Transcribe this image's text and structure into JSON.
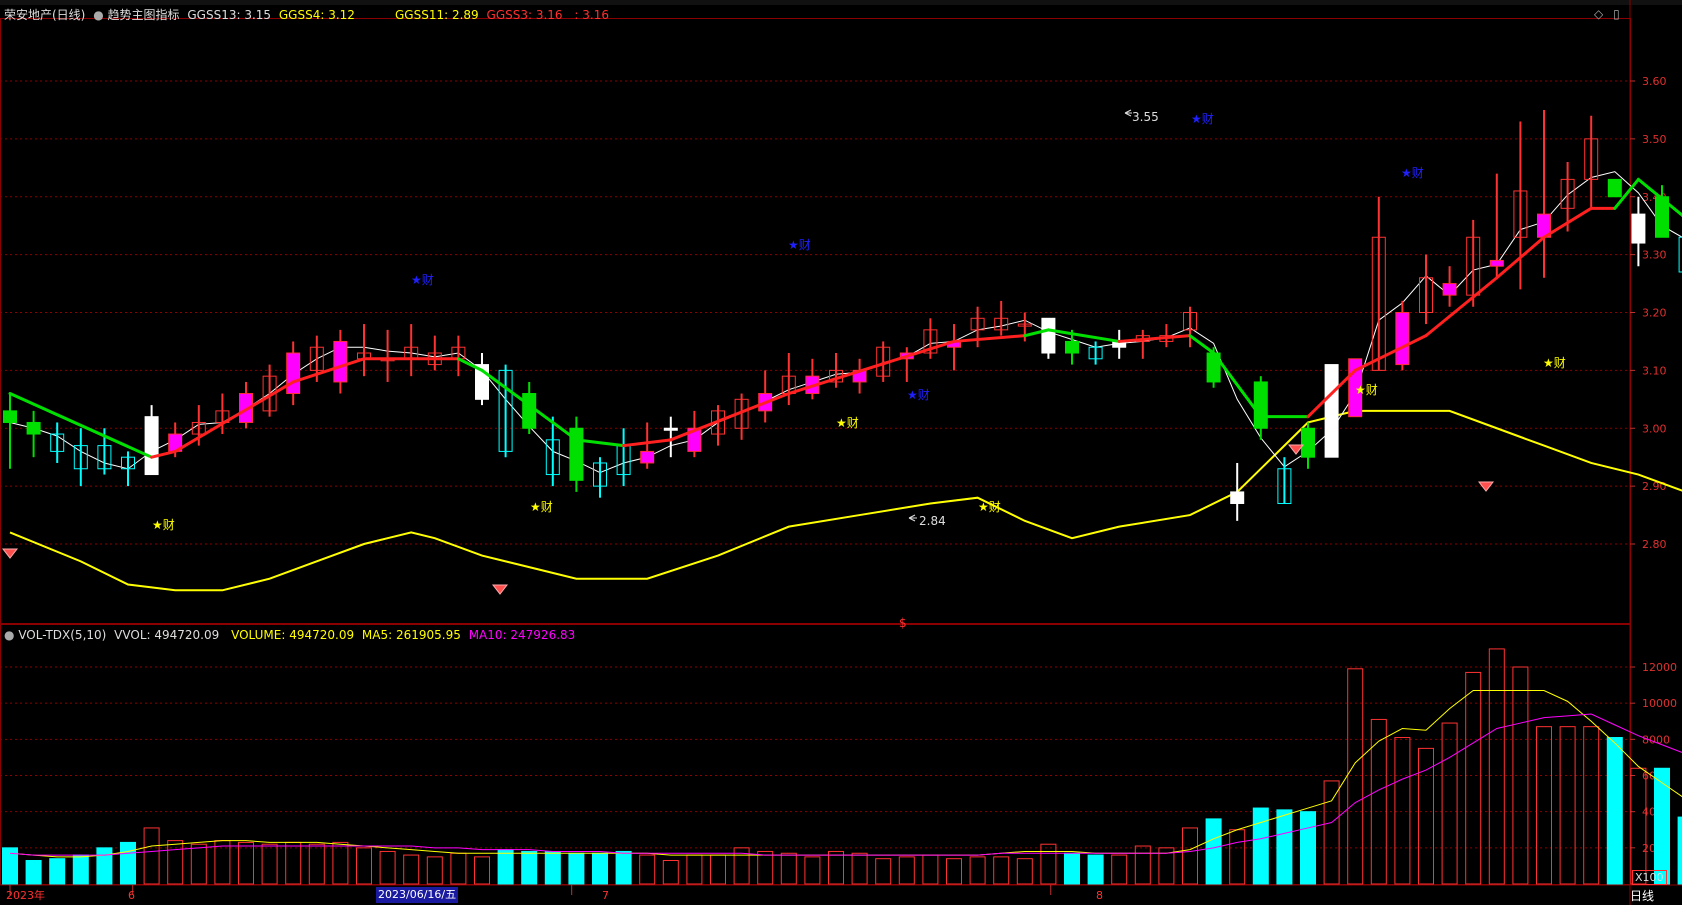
{
  "header": {
    "stock_name": "荣安地产(日线)",
    "indicator_name": "趋势主图指标",
    "ggss13": "GGSS13: 3.15",
    "ggss4": "GGSS4: 3.12",
    "ggss11": "GGSS11: 2.89",
    "ggss3": "GGSS3: 3.16",
    "extra": ": 3.16"
  },
  "vol_header": {
    "name": "VOL-TDX(5,10)",
    "vvol": "VVOL: 494720.09",
    "volume": "VOLUME: 494720.09",
    "ma5": "MA5: 261905.95",
    "ma10": "MA10: 247926.83"
  },
  "bottom": {
    "year_label": "2023年",
    "m6": "6",
    "date_label": "2023/06/16/五",
    "m7": "7",
    "m8": "8",
    "period": "日线",
    "vol_unit": "X100"
  },
  "annotations": {
    "high_label": "3.55",
    "low_label": "2.84",
    "cai": "★财",
    "dollar": "$"
  },
  "colors": {
    "up": "#ff3232",
    "up_fill": "#ff00ff",
    "down": "#00ffff",
    "white": "#ffffff",
    "green_line": "#00e000",
    "red_line": "#ff2020",
    "yellow": "#ffff00",
    "magenta": "#ff00ff",
    "grid": "#8b0000"
  },
  "chart_data": {
    "type": "candlestick",
    "price_axis": {
      "ticks": [
        2.8,
        2.9,
        3.0,
        3.1,
        3.2,
        3.3,
        3.4,
        3.5,
        3.6
      ]
    },
    "volume_axis": {
      "ticks": [
        2000,
        4000,
        6000,
        8000,
        10000,
        12000
      ]
    },
    "candles": [
      {
        "o": 3.03,
        "h": 3.06,
        "l": 2.93,
        "c": 3.01,
        "v": 2000,
        "k": "g"
      },
      {
        "o": 3.01,
        "h": 3.03,
        "l": 2.95,
        "c": 2.99,
        "v": 1300,
        "k": "g"
      },
      {
        "o": 2.99,
        "h": 3.01,
        "l": 2.94,
        "c": 2.96,
        "v": 1400,
        "k": "d"
      },
      {
        "o": 2.97,
        "h": 3.0,
        "l": 2.9,
        "c": 2.93,
        "v": 1600,
        "k": "d"
      },
      {
        "o": 2.97,
        "h": 3.0,
        "l": 2.92,
        "c": 2.93,
        "v": 2000,
        "k": "d"
      },
      {
        "o": 2.95,
        "h": 2.96,
        "l": 2.9,
        "c": 2.93,
        "v": 2300,
        "k": "d"
      },
      {
        "o": 2.92,
        "h": 3.04,
        "l": 2.92,
        "c": 3.02,
        "v": 3100,
        "k": "w"
      },
      {
        "o": 2.96,
        "h": 3.01,
        "l": 2.95,
        "c": 2.99,
        "v": 2400,
        "k": "m"
      },
      {
        "o": 2.99,
        "h": 3.04,
        "l": 2.97,
        "c": 3.01,
        "v": 2200,
        "k": "r"
      },
      {
        "o": 3.01,
        "h": 3.06,
        "l": 2.99,
        "c": 3.03,
        "v": 2400,
        "k": "r"
      },
      {
        "o": 3.01,
        "h": 3.08,
        "l": 3.0,
        "c": 3.06,
        "v": 2300,
        "k": "m"
      },
      {
        "o": 3.03,
        "h": 3.11,
        "l": 3.02,
        "c": 3.09,
        "v": 2200,
        "k": "r"
      },
      {
        "o": 3.06,
        "h": 3.15,
        "l": 3.04,
        "c": 3.13,
        "v": 2300,
        "k": "m"
      },
      {
        "o": 3.1,
        "h": 3.16,
        "l": 3.08,
        "c": 3.14,
        "v": 2200,
        "k": "r"
      },
      {
        "o": 3.08,
        "h": 3.17,
        "l": 3.06,
        "c": 3.15,
        "v": 2300,
        "k": "m"
      },
      {
        "o": 3.12,
        "h": 3.18,
        "l": 3.09,
        "c": 3.13,
        "v": 2000,
        "k": "r"
      },
      {
        "o": 3.12,
        "h": 3.17,
        "l": 3.08,
        "c": 3.12,
        "v": 1800,
        "k": "r"
      },
      {
        "o": 3.12,
        "h": 3.18,
        "l": 3.09,
        "c": 3.14,
        "v": 1600,
        "k": "r"
      },
      {
        "o": 3.13,
        "h": 3.16,
        "l": 3.1,
        "c": 3.11,
        "v": 1500,
        "k": "r"
      },
      {
        "o": 3.12,
        "h": 3.16,
        "l": 3.09,
        "c": 3.14,
        "v": 1700,
        "k": "r"
      },
      {
        "o": 3.11,
        "h": 3.13,
        "l": 3.04,
        "c": 3.05,
        "v": 1500,
        "k": "w"
      },
      {
        "o": 3.1,
        "h": 3.11,
        "l": 2.95,
        "c": 2.96,
        "v": 1900,
        "k": "d"
      },
      {
        "o": 3.06,
        "h": 3.08,
        "l": 2.99,
        "c": 3.0,
        "v": 1800,
        "k": "g"
      },
      {
        "o": 2.98,
        "h": 3.02,
        "l": 2.9,
        "c": 2.92,
        "v": 1800,
        "k": "d"
      },
      {
        "o": 3.0,
        "h": 3.02,
        "l": 2.89,
        "c": 2.91,
        "v": 1700,
        "k": "g"
      },
      {
        "o": 2.9,
        "h": 2.95,
        "l": 2.88,
        "c": 2.94,
        "v": 1700,
        "k": "d"
      },
      {
        "o": 2.92,
        "h": 3.0,
        "l": 2.9,
        "c": 2.97,
        "v": 1800,
        "k": "d"
      },
      {
        "o": 2.96,
        "h": 3.01,
        "l": 2.93,
        "c": 2.94,
        "v": 1600,
        "k": "m"
      },
      {
        "o": 3.0,
        "h": 3.02,
        "l": 2.95,
        "c": 3.0,
        "v": 1300,
        "k": "w"
      },
      {
        "o": 2.96,
        "h": 3.03,
        "l": 2.95,
        "c": 3.0,
        "v": 1600,
        "k": "m"
      },
      {
        "o": 2.99,
        "h": 3.04,
        "l": 2.97,
        "c": 3.03,
        "v": 1600,
        "k": "r"
      },
      {
        "o": 3.0,
        "h": 3.06,
        "l": 2.98,
        "c": 3.05,
        "v": 2000,
        "k": "r"
      },
      {
        "o": 3.03,
        "h": 3.1,
        "l": 3.01,
        "c": 3.06,
        "v": 1800,
        "k": "m"
      },
      {
        "o": 3.06,
        "h": 3.13,
        "l": 3.04,
        "c": 3.09,
        "v": 1700,
        "k": "r"
      },
      {
        "o": 3.06,
        "h": 3.12,
        "l": 3.05,
        "c": 3.09,
        "v": 1500,
        "k": "m"
      },
      {
        "o": 3.08,
        "h": 3.13,
        "l": 3.07,
        "c": 3.1,
        "v": 1800,
        "k": "r"
      },
      {
        "o": 3.08,
        "h": 3.12,
        "l": 3.06,
        "c": 3.1,
        "v": 1700,
        "k": "m"
      },
      {
        "o": 3.09,
        "h": 3.15,
        "l": 3.08,
        "c": 3.14,
        "v": 1400,
        "k": "r"
      },
      {
        "o": 3.12,
        "h": 3.14,
        "l": 3.08,
        "c": 3.13,
        "v": 1500,
        "k": "m"
      },
      {
        "o": 3.13,
        "h": 3.19,
        "l": 3.12,
        "c": 3.17,
        "v": 1600,
        "k": "r"
      },
      {
        "o": 3.14,
        "h": 3.18,
        "l": 3.1,
        "c": 3.15,
        "v": 1400,
        "k": "m"
      },
      {
        "o": 3.17,
        "h": 3.21,
        "l": 3.14,
        "c": 3.19,
        "v": 1500,
        "k": "r"
      },
      {
        "o": 3.17,
        "h": 3.22,
        "l": 3.16,
        "c": 3.19,
        "v": 1500,
        "k": "r"
      },
      {
        "o": 3.18,
        "h": 3.2,
        "l": 3.15,
        "c": 3.18,
        "v": 1400,
        "k": "r"
      },
      {
        "o": 3.19,
        "h": 3.19,
        "l": 3.12,
        "c": 3.13,
        "v": 2200,
        "k": "w"
      },
      {
        "o": 3.13,
        "h": 3.17,
        "l": 3.11,
        "c": 3.15,
        "v": 1700,
        "k": "g"
      },
      {
        "o": 3.12,
        "h": 3.15,
        "l": 3.11,
        "c": 3.14,
        "v": 1600,
        "k": "d"
      },
      {
        "o": 3.14,
        "h": 3.17,
        "l": 3.12,
        "c": 3.15,
        "v": 1600,
        "k": "w"
      },
      {
        "o": 3.15,
        "h": 3.17,
        "l": 3.12,
        "c": 3.16,
        "v": 2100,
        "k": "r"
      },
      {
        "o": 3.15,
        "h": 3.18,
        "l": 3.14,
        "c": 3.16,
        "v": 2000,
        "k": "r"
      },
      {
        "o": 3.17,
        "h": 3.21,
        "l": 3.14,
        "c": 3.2,
        "v": 3100,
        "k": "r"
      },
      {
        "o": 3.13,
        "h": 3.14,
        "l": 3.07,
        "c": 3.08,
        "v": 3600,
        "k": "g"
      },
      {
        "o": 2.89,
        "h": 2.94,
        "l": 2.84,
        "c": 2.87,
        "v": 3000,
        "k": "w"
      },
      {
        "o": 3.08,
        "h": 3.09,
        "l": 2.98,
        "c": 3.0,
        "v": 4200,
        "k": "g"
      },
      {
        "o": 2.87,
        "h": 2.95,
        "l": 2.87,
        "c": 2.93,
        "v": 4100,
        "k": "d"
      },
      {
        "o": 3.0,
        "h": 3.01,
        "l": 2.93,
        "c": 2.95,
        "v": 4000,
        "k": "g"
      },
      {
        "o": 2.95,
        "h": 3.11,
        "l": 2.95,
        "c": 3.11,
        "v": 5700,
        "k": "w"
      },
      {
        "o": 3.02,
        "h": 3.12,
        "l": 3.02,
        "c": 3.12,
        "v": 11900,
        "k": "m"
      },
      {
        "o": 3.1,
        "h": 3.4,
        "l": 3.1,
        "c": 3.33,
        "v": 9100,
        "k": "r"
      },
      {
        "o": 3.11,
        "h": 3.22,
        "l": 3.1,
        "c": 3.2,
        "v": 8100,
        "k": "m"
      },
      {
        "o": 3.2,
        "h": 3.3,
        "l": 3.18,
        "c": 3.26,
        "v": 7500,
        "k": "r"
      },
      {
        "o": 3.25,
        "h": 3.28,
        "l": 3.21,
        "c": 3.23,
        "v": 8900,
        "k": "m"
      },
      {
        "o": 3.23,
        "h": 3.36,
        "l": 3.21,
        "c": 3.33,
        "v": 11700,
        "k": "r"
      },
      {
        "o": 3.28,
        "h": 3.44,
        "l": 3.26,
        "c": 3.29,
        "v": 13000,
        "k": "m"
      },
      {
        "o": 3.33,
        "h": 3.53,
        "l": 3.24,
        "c": 3.41,
        "v": 12000,
        "k": "r"
      },
      {
        "o": 3.33,
        "h": 3.55,
        "l": 3.26,
        "c": 3.37,
        "v": 8700,
        "k": "m"
      },
      {
        "o": 3.38,
        "h": 3.46,
        "l": 3.34,
        "c": 3.43,
        "v": 8700,
        "k": "r"
      },
      {
        "o": 3.43,
        "h": 3.54,
        "l": 3.38,
        "c": 3.5,
        "v": 8700,
        "k": "r"
      },
      {
        "o": 3.43,
        "h": 3.43,
        "l": 3.4,
        "c": 3.4,
        "v": 8100,
        "k": "g"
      },
      {
        "o": 3.37,
        "h": 3.4,
        "l": 3.28,
        "c": 3.32,
        "v": 6400,
        "k": "w"
      },
      {
        "o": 3.4,
        "h": 3.42,
        "l": 3.33,
        "c": 3.33,
        "v": 6400,
        "k": "g"
      },
      {
        "o": 3.27,
        "h": 3.35,
        "l": 3.24,
        "c": 3.33,
        "v": 3700,
        "k": "d"
      },
      {
        "o": 3.33,
        "h": 3.35,
        "l": 3.27,
        "c": 3.28,
        "v": 2600,
        "k": "g"
      },
      {
        "o": 3.23,
        "h": 3.3,
        "l": 3.2,
        "c": 3.28,
        "v": 2700,
        "k": "d"
      },
      {
        "o": 3.28,
        "h": 3.3,
        "l": 3.24,
        "c": 3.26,
        "v": 2700,
        "k": "g"
      },
      {
        "o": 3.23,
        "h": 3.32,
        "l": 3.2,
        "c": 3.27,
        "v": 3800,
        "k": "d"
      },
      {
        "o": 3.24,
        "h": 3.25,
        "l": 3.23,
        "c": 3.23,
        "v": 3100,
        "k": "g"
      },
      {
        "o": 3.17,
        "h": 3.21,
        "l": 3.13,
        "c": 3.21,
        "v": 2900,
        "k": "d"
      },
      {
        "o": 3.23,
        "h": 3.24,
        "l": 3.21,
        "c": 3.21,
        "v": 2400,
        "k": "g"
      },
      {
        "o": 3.2,
        "h": 3.23,
        "l": 3.16,
        "c": 3.2,
        "v": 2100,
        "k": "d"
      },
      {
        "o": 3.2,
        "h": 3.31,
        "l": 3.16,
        "c": 3.27,
        "v": 2700,
        "k": "w"
      },
      {
        "o": 3.24,
        "h": 3.28,
        "l": 3.22,
        "c": 3.26,
        "v": 2600,
        "k": "r"
      },
      {
        "o": 3.26,
        "h": 3.31,
        "l": 3.18,
        "c": 3.19,
        "v": 2900,
        "k": "w"
      },
      {
        "o": 3.21,
        "h": 3.22,
        "l": 3.18,
        "c": 3.18,
        "v": 2400,
        "k": "g"
      },
      {
        "o": 3.13,
        "h": 3.2,
        "l": 3.12,
        "c": 3.19,
        "v": 2300,
        "k": "d"
      },
      {
        "o": 3.19,
        "h": 3.19,
        "l": 3.15,
        "c": 3.16,
        "v": 2200,
        "k": "g"
      },
      {
        "o": 3.13,
        "h": 3.16,
        "l": 3.12,
        "c": 3.16,
        "v": 2100,
        "k": "d"
      },
      {
        "o": 3.15,
        "h": 3.15,
        "l": 3.11,
        "c": 3.12,
        "v": 2000,
        "k": "g"
      },
      {
        "o": 3.09,
        "h": 3.13,
        "l": 3.06,
        "c": 3.12,
        "v": 2000,
        "k": "d"
      },
      {
        "o": 3.09,
        "h": 3.14,
        "l": 3.06,
        "c": 3.12,
        "v": 1900,
        "k": "d"
      },
      {
        "o": 3.09,
        "h": 3.12,
        "l": 3.08,
        "c": 3.1,
        "v": 1800,
        "k": "d"
      },
      {
        "o": 3.12,
        "h": 3.16,
        "l": 3.1,
        "c": 3.15,
        "v": 1900,
        "k": "m"
      },
      {
        "o": 3.26,
        "h": 3.33,
        "l": 3.21,
        "c": 3.27,
        "v": 4900,
        "k": "w"
      }
    ],
    "upper_line_green_red": [
      {
        "i": 0,
        "p": 3.06,
        "c": "g"
      },
      {
        "i": 6,
        "p": 2.95,
        "c": "g"
      },
      {
        "i": 7,
        "p": 2.96,
        "c": "r"
      },
      {
        "i": 12,
        "p": 3.08,
        "c": "r"
      },
      {
        "i": 15,
        "p": 3.12,
        "c": "r"
      },
      {
        "i": 19,
        "p": 3.12,
        "c": "r"
      },
      {
        "i": 20,
        "p": 3.1,
        "c": "g"
      },
      {
        "i": 24,
        "p": 2.98,
        "c": "g"
      },
      {
        "i": 26,
        "p": 2.97,
        "c": "g"
      },
      {
        "i": 28,
        "p": 2.98,
        "c": "r"
      },
      {
        "i": 33,
        "p": 3.06,
        "c": "r"
      },
      {
        "i": 40,
        "p": 3.15,
        "c": "r"
      },
      {
        "i": 43,
        "p": 3.16,
        "c": "r"
      },
      {
        "i": 44,
        "p": 3.17,
        "c": "g"
      },
      {
        "i": 47,
        "p": 3.15,
        "c": "g"
      },
      {
        "i": 50,
        "p": 3.16,
        "c": "r"
      },
      {
        "i": 51,
        "p": 3.13,
        "c": "g"
      },
      {
        "i": 53,
        "p": 3.02,
        "c": "g"
      },
      {
        "i": 55,
        "p": 3.02,
        "c": "g"
      },
      {
        "i": 57,
        "p": 3.1,
        "c": "r"
      },
      {
        "i": 60,
        "p": 3.16,
        "c": "r"
      },
      {
        "i": 63,
        "p": 3.26,
        "c": "r"
      },
      {
        "i": 65,
        "p": 3.33,
        "c": "r"
      },
      {
        "i": 67,
        "p": 3.38,
        "c": "r"
      },
      {
        "i": 68,
        "p": 3.38,
        "c": "r"
      },
      {
        "i": 69,
        "p": 3.43,
        "c": "g"
      },
      {
        "i": 72,
        "p": 3.33,
        "c": "g"
      },
      {
        "i": 76,
        "p": 3.24,
        "c": "g"
      },
      {
        "i": 80,
        "p": 3.23,
        "c": "g"
      },
      {
        "i": 84,
        "p": 3.2,
        "c": "g"
      },
      {
        "i": 88,
        "p": 3.14,
        "c": "g"
      },
      {
        "i": 89,
        "p": 3.14,
        "c": "r"
      },
      {
        "i": 90,
        "p": 3.16,
        "c": "r"
      }
    ],
    "yellow_band": [
      {
        "i": 0,
        "p": 2.82
      },
      {
        "i": 3,
        "p": 2.77
      },
      {
        "i": 5,
        "p": 2.73
      },
      {
        "i": 7,
        "p": 2.72
      },
      {
        "i": 9,
        "p": 2.72
      },
      {
        "i": 11,
        "p": 2.74
      },
      {
        "i": 13,
        "p": 2.77
      },
      {
        "i": 15,
        "p": 2.8
      },
      {
        "i": 16,
        "p": 2.81
      },
      {
        "i": 17,
        "p": 2.82
      },
      {
        "i": 18,
        "p": 2.81
      },
      {
        "i": 20,
        "p": 2.78
      },
      {
        "i": 22,
        "p": 2.76
      },
      {
        "i": 24,
        "p": 2.74
      },
      {
        "i": 27,
        "p": 2.74
      },
      {
        "i": 30,
        "p": 2.78
      },
      {
        "i": 33,
        "p": 2.83
      },
      {
        "i": 36,
        "p": 2.85
      },
      {
        "i": 39,
        "p": 2.87
      },
      {
        "i": 41,
        "p": 2.88
      },
      {
        "i": 43,
        "p": 2.84
      },
      {
        "i": 45,
        "p": 2.81
      },
      {
        "i": 47,
        "p": 2.83
      },
      {
        "i": 50,
        "p": 2.85
      },
      {
        "i": 52,
        "p": 2.89
      },
      {
        "i": 54,
        "p": 2.97
      },
      {
        "i": 55,
        "p": 3.01
      },
      {
        "i": 57,
        "p": 3.03
      },
      {
        "i": 59,
        "p": 3.03
      },
      {
        "i": 61,
        "p": 3.03
      },
      {
        "i": 63,
        "p": 3.0
      },
      {
        "i": 65,
        "p": 2.97
      },
      {
        "i": 67,
        "p": 2.94
      },
      {
        "i": 69,
        "p": 2.92
      },
      {
        "i": 71,
        "p": 2.89
      },
      {
        "i": 73,
        "p": 2.88
      }
    ],
    "vol_ma5": [
      1700,
      1600,
      1500,
      1500,
      1600,
      1800,
      2100,
      2200,
      2300,
      2400,
      2400,
      2300,
      2300,
      2300,
      2200,
      2100,
      2000,
      1900,
      1800,
      1700,
      1700,
      1700,
      1700,
      1700,
      1700,
      1700,
      1700,
      1700,
      1600,
      1600,
      1600,
      1600,
      1600,
      1600,
      1600,
      1600,
      1600,
      1600,
      1600,
      1600,
      1600,
      1600,
      1700,
      1800,
      1800,
      1800,
      1700,
      1700,
      1700,
      1700,
      1900,
      2500,
      3000,
      3400,
      3800,
      4200,
      4600,
      6700,
      7900,
      8600,
      8500,
      9700,
      10700,
      10700,
      10700,
      10700,
      10100,
      9000,
      7800,
      6500,
      5600,
      4700,
      3900,
      3400,
      3100,
      3000,
      2900,
      2800,
      2700,
      2600,
      2500,
      2400,
      2300,
      2300,
      2200,
      2200,
      2100,
      2000,
      1900,
      2000,
      2500
    ],
    "vol_ma10": [
      1700,
      1600,
      1600,
      1600,
      1600,
      1700,
      1800,
      1900,
      2000,
      2100,
      2100,
      2100,
      2100,
      2100,
      2100,
      2100,
      2100,
      2100,
      2000,
      2000,
      1900,
      1900,
      1900,
      1800,
      1800,
      1800,
      1700,
      1700,
      1700,
      1700,
      1700,
      1700,
      1600,
      1600,
      1600,
      1600,
      1600,
      1600,
      1600,
      1600,
      1600,
      1600,
      1700,
      1700,
      1700,
      1700,
      1700,
      1700,
      1700,
      1700,
      1800,
      2000,
      2300,
      2500,
      2800,
      3100,
      3400,
      4500,
      5200,
      5800,
      6300,
      7000,
      7800,
      8600,
      8900,
      9200,
      9300,
      9400,
      8800,
      8200,
      7700,
      7200,
      6400,
      5600,
      4900,
      4400,
      4000,
      3600,
      3300,
      3100,
      2900,
      2700,
      2600,
      2500,
      2400,
      2400,
      2300,
      2200,
      2200,
      2200,
      2300
    ]
  }
}
